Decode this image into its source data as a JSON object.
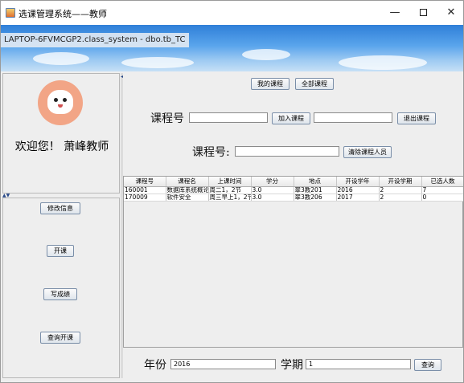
{
  "window": {
    "title": "选课管理系统——教师",
    "controls": {
      "minimize": "—",
      "close": "✕"
    },
    "banner_tab": "LAPTOP-6FVMCGP2.class_system - dbo.tb_TC"
  },
  "sidebar": {
    "welcome": "欢迎您！ 萧峰教师",
    "buttons": [
      "修改信息",
      "开课",
      "写成绩",
      "查询开课"
    ]
  },
  "main": {
    "top_buttons": {
      "my_courses": "我的课程",
      "all_courses": "全部课程"
    },
    "course_label": "课程号",
    "course_label2": "课程号:",
    "add_course": "加入课程",
    "exit_course": "退出课程",
    "clear_students": "清除课程人员",
    "table": {
      "headers": [
        "课程号",
        "课程名",
        "上课时间",
        "学分",
        "地点",
        "开设学年",
        "开设学期",
        "已选人数"
      ],
      "rows": [
        [
          "160001",
          "数据库系统概论",
          "周二1，2节",
          "3.0",
          "翠3教201",
          "2016",
          "2",
          "7"
        ],
        [
          "170009",
          "软件安全",
          "周三早上1，2节",
          "3.0",
          "翠3教206",
          "2017",
          "2",
          "0"
        ]
      ]
    },
    "filter": {
      "year_label": "年份",
      "year_value": "2016",
      "term_label": "学期",
      "term_value": "1",
      "query": "查询"
    }
  },
  "icons": [
    "app-icon",
    "avatar-icon",
    "splitter-arrow-icon"
  ]
}
